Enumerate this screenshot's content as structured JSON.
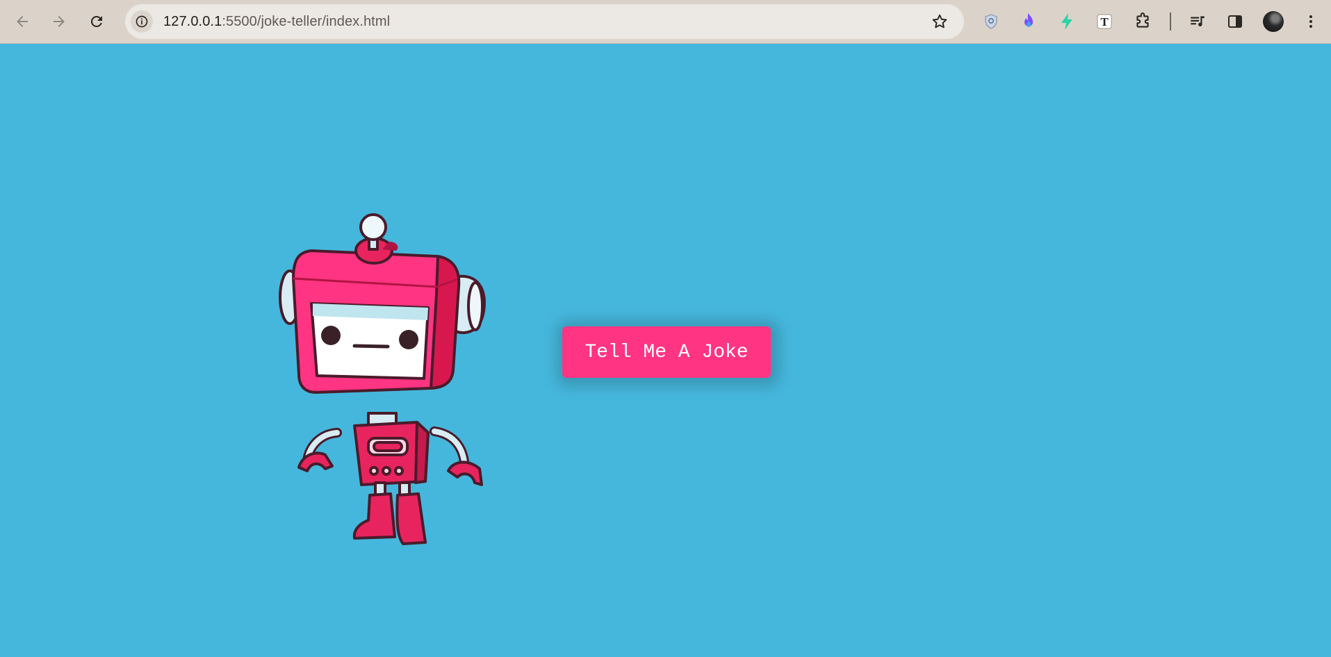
{
  "browser": {
    "url_host": "127.0.0.1",
    "url_path": ":5500/joke-teller/index.html",
    "icons": {
      "back": "arrow-left-icon",
      "forward": "arrow-right-icon",
      "reload": "reload-icon",
      "site_info": "info-icon",
      "bookmark": "star-icon",
      "extensions": [
        "shield-icon",
        "flame-icon",
        "bolt-icon",
        "text-t-icon",
        "puzzle-icon"
      ],
      "media": "playlist-icon",
      "side_panel": "side-panel-icon",
      "menu": "kebab-menu-icon"
    }
  },
  "page": {
    "background_color": "#45b7dc",
    "robot_image": "pink-robot-illustration",
    "button_label": "Tell Me A Joke",
    "button_color": "#ff3482"
  }
}
